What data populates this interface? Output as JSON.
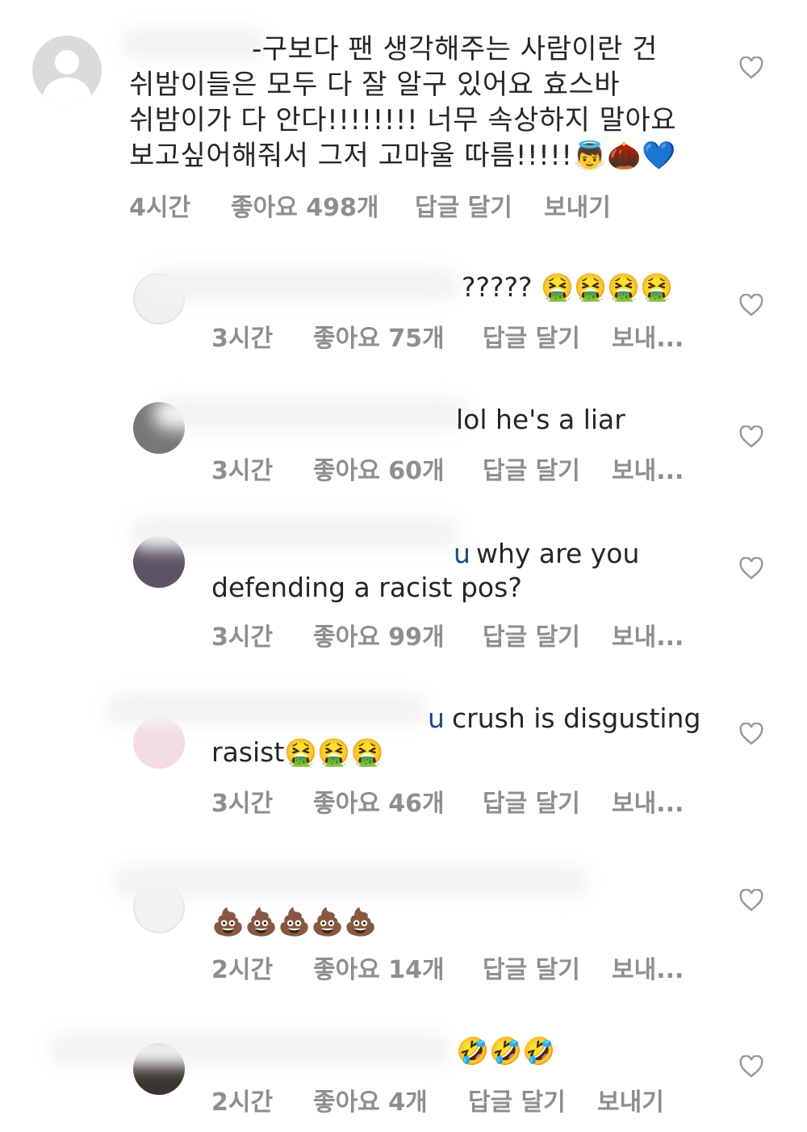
{
  "comments": [
    {
      "lines": [
        "-구보다 팬 생각해주는 사람이란 건",
        "쉬밤이들은 모두 다 잘 알구 있어요 효스바",
        "쉬밤이가 다 안다!!!!!!!! 너무 속상하지 말아요",
        "보고싶어해줘서 그저 고마울 따름!!!!!👼🌰💙"
      ],
      "time": "4시간",
      "likes": "좋아요 498개",
      "reply": "답글 달기",
      "send": "보내기"
    },
    {
      "lines": [
        "????? 🤮🤮🤮🤮"
      ],
      "time": "3시간",
      "likes": "좋아요 75개",
      "reply": "답글 달기",
      "send": "보내..."
    },
    {
      "lines": [
        "lol he's a liar"
      ],
      "time": "3시간",
      "likes": "좋아요 60개",
      "reply": "답글 달기",
      "send": "보내..."
    },
    {
      "lines": [
        "why are you",
        "defending a racist pos?"
      ],
      "mention_tail": "u",
      "time": "3시간",
      "likes": "좋아요 99개",
      "reply": "답글 달기",
      "send": "보내..."
    },
    {
      "mention_tail": "u",
      "lines": [
        "crush is disgusting",
        "rasist🤮🤮🤮"
      ],
      "time": "3시간",
      "likes": "좋아요 46개",
      "reply": "답글 달기",
      "send": "보내..."
    },
    {
      "lines": [
        "💩💩💩💩💩"
      ],
      "time": "2시간",
      "likes": "좋아요 14개",
      "reply": "답글 달기",
      "send": "보내..."
    },
    {
      "lines": [
        "🤣🤣🤣"
      ],
      "time": "2시간",
      "likes": "좋아요 4개",
      "reply": "답글 달기",
      "send": "보내기"
    }
  ],
  "icons": {
    "like": "heart-outline-icon",
    "avatar": "default-profile-icon"
  },
  "colors": {
    "text": "#262626",
    "meta": "#8e8e8e",
    "mention": "#1a4a86"
  }
}
